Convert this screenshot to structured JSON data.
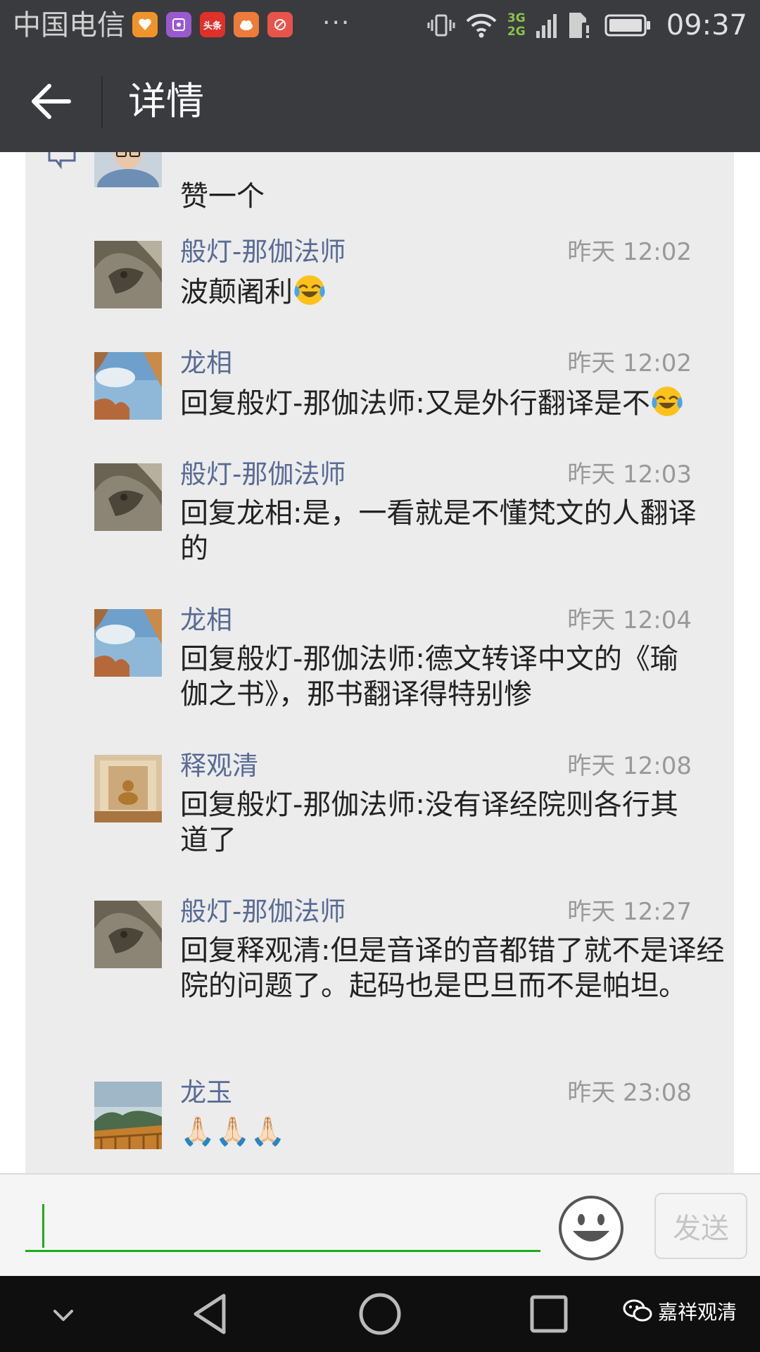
{
  "status_bar": {
    "carrier": "中国电信",
    "more": "···",
    "net_top": "3G",
    "net_bottom": "2G",
    "time": "09:37",
    "app_icons": [
      {
        "name": "app-icon-orange",
        "color": "#f0932b"
      },
      {
        "name": "app-icon-purple",
        "color": "#9b59d0"
      },
      {
        "name": "app-icon-toutiao",
        "color": "#e0302a",
        "text": "头条"
      },
      {
        "name": "app-icon-orange-cloud",
        "color": "#ee7b3a"
      },
      {
        "name": "app-icon-red-tools",
        "color": "#e8534a"
      }
    ]
  },
  "header": {
    "title": "详情"
  },
  "comments": [
    {
      "name": "",
      "time": "",
      "text": "赞一个",
      "avatar": "person"
    },
    {
      "name": "般灯-那伽法师",
      "time": "昨天 12:02",
      "text": "波颠阇利",
      "emoji": "laugh-cry",
      "avatar": "stone"
    },
    {
      "name": "龙相",
      "time": "昨天 12:02",
      "text": "回复般灯-那伽法师:又是外行翻译是不",
      "emoji": "laugh-cry",
      "avatar": "sky"
    },
    {
      "name": "般灯-那伽法师",
      "time": "昨天 12:03",
      "text": "回复龙相:是，一看就是不懂梵文的人翻译的",
      "avatar": "stone"
    },
    {
      "name": "龙相",
      "time": "昨天 12:04",
      "text": "回复般灯-那伽法师:德文转译中文的《瑜伽之书》，那书翻译得特别惨",
      "avatar": "sky"
    },
    {
      "name": "释观清",
      "time": "昨天 12:08",
      "text": "回复般灯-那伽法师:没有译经院则各行其道了",
      "avatar": "shrine"
    },
    {
      "name": "般灯-那伽法师",
      "time": "昨天 12:27",
      "text": "回复释观清:但是音译的音都错了就不是译经院的问题了。起码也是巴旦而不是帕坦。",
      "avatar": "stone"
    },
    {
      "name": "龙玉",
      "time": "昨天 23:08",
      "text": "🙏🏻🙏🏻🙏🏻",
      "avatar": "landscape"
    }
  ],
  "input": {
    "placeholder": "",
    "value": "",
    "send_label": "发送"
  },
  "watermark": {
    "text": "嘉祥观清"
  },
  "colors": {
    "bar_dark": "#3a3b3f",
    "name_blue": "#576b95",
    "accent_green": "#1aad19",
    "panel_gray": "#ececec"
  }
}
